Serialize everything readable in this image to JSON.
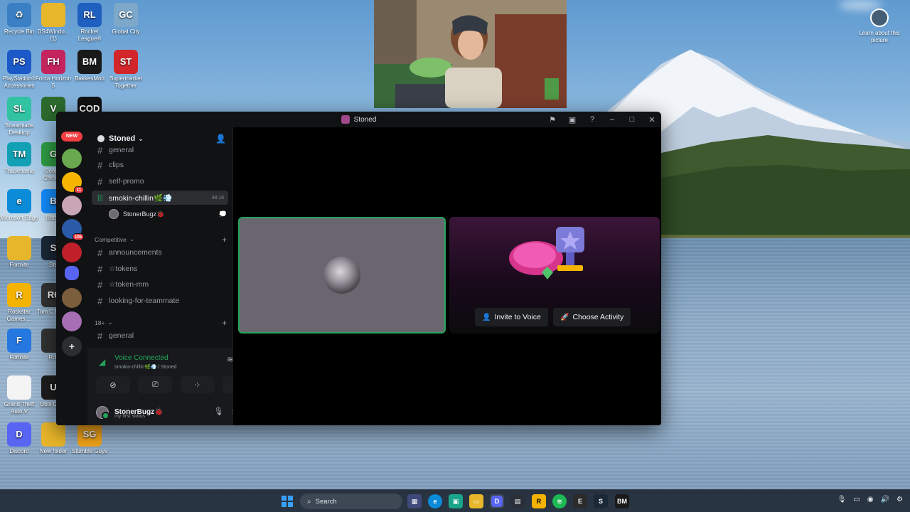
{
  "desktop": {
    "icons": [
      {
        "id": "recycle",
        "label": "Recycle Bin",
        "glyph": "♻",
        "color": "#3b7fc4"
      },
      {
        "id": "ds4",
        "label": "DS4Windo... (1)",
        "glyph": "",
        "color": "#e8b62a"
      },
      {
        "id": "rocket",
        "label": "Rocket League®",
        "glyph": "RL",
        "color": "#1f5fbf"
      },
      {
        "id": "globalcity",
        "label": "Global City",
        "glyph": "GC",
        "color": "#7ea8c9"
      },
      {
        "id": "psacc",
        "label": "PlayStation® Accessories",
        "glyph": "PS",
        "color": "#1b59c8"
      },
      {
        "id": "forza",
        "label": "Forza Horizon 5",
        "glyph": "FH",
        "color": "#c4245e"
      },
      {
        "id": "bakkes",
        "label": "BakkesMod",
        "glyph": "BM",
        "color": "#1a1a1a"
      },
      {
        "id": "supermarket",
        "label": "Supermarket Together",
        "glyph": "ST",
        "color": "#d3262a"
      },
      {
        "id": "streamlabs",
        "label": "Streamlabs Desktop",
        "glyph": "SL",
        "color": "#31c3a2"
      },
      {
        "id": "gta",
        "label": "",
        "glyph": "V",
        "color": "#2d6b2d"
      },
      {
        "id": "cod",
        "label": "",
        "glyph": "COD",
        "color": "#111111"
      },
      {
        "id": "trackmania",
        "label": "Trackmania",
        "glyph": "TM",
        "color": "#12a0b5"
      },
      {
        "id": "chrome",
        "label": "Google Chrome",
        "glyph": "G",
        "color": "#2f9e44"
      },
      {
        "id": "edge",
        "label": "Microsoft Edge",
        "glyph": "e",
        "color": "#0c8bd8"
      },
      {
        "id": "battlenet",
        "label": "Battle",
        "glyph": "B",
        "color": "#148eff"
      },
      {
        "id": "fortnite1",
        "label": "Fortnite",
        "glyph": "",
        "color": "#e8b62a"
      },
      {
        "id": "steam1",
        "label": "Ste",
        "glyph": "S",
        "color": "#1b2838"
      },
      {
        "id": "rockstar",
        "label": "Rockstar Games ...",
        "glyph": "R",
        "color": "#f4b300"
      },
      {
        "id": "tomclancy",
        "label": "Tom C Rainb",
        "glyph": "R6",
        "color": "#333333"
      },
      {
        "id": "fortnite2",
        "label": "Fortnite",
        "glyph": "F",
        "color": "#2478e0"
      },
      {
        "id": "rel",
        "label": "R.E",
        "glyph": "",
        "color": "#333333"
      },
      {
        "id": "gtav",
        "label": "Grand Theft Auto V",
        "glyph": "",
        "color": "#f4f4f4"
      },
      {
        "id": "ubisoft",
        "label": "Ubis Conn",
        "glyph": "U",
        "color": "#1d1d1d"
      },
      {
        "id": "discord",
        "label": "Discord",
        "glyph": "D",
        "color": "#5865f2"
      },
      {
        "id": "newfolder",
        "label": "New folder",
        "glyph": "",
        "color": "#e8b62a"
      },
      {
        "id": "stumble",
        "label": "Stumble Guys",
        "glyph": "SG",
        "color": "#f2a51a"
      }
    ],
    "learn_text": "Learn about this picture"
  },
  "discord": {
    "window_title": "Stoned",
    "server_name": "Stoned",
    "new_badge": "NEW",
    "guild_badges": [
      "11",
      "105"
    ],
    "channels_top": [
      {
        "name": "general",
        "partial": true
      },
      {
        "name": "clips"
      },
      {
        "name": "self-promo"
      }
    ],
    "voice_channel": {
      "name": "smokin-chillin🌿💨",
      "timer": "48:18"
    },
    "voice_user": {
      "name": "StonerBugz🐞"
    },
    "category_competitive": "Competitive",
    "competitive_channels": [
      "announcements",
      "☆tokens",
      "☆token-mm",
      "looking-for-teammate"
    ],
    "category_18": "18+",
    "channels_18": [
      "general"
    ],
    "voice_panel": {
      "status": "Voice Connected",
      "sub": "smokin-chillin🌿💨 / Stoned"
    },
    "user_panel": {
      "name": "StonerBugz🐞",
      "status": "my first status"
    },
    "activity": {
      "invite_label": "Invite to Voice",
      "choose_label": "Choose Activity"
    }
  },
  "taskbar": {
    "search_placeholder": "Search",
    "apps": [
      "task-view",
      "edge",
      "chat",
      "explorer",
      "discord",
      "store",
      "rockstar",
      "spotify",
      "epic",
      "steam",
      "bakkes"
    ]
  },
  "colors": {
    "discord_bg": "#111214",
    "voice_green": "#23a55a",
    "badge_red": "#f23f43",
    "accent_blue": "#5865f2"
  }
}
